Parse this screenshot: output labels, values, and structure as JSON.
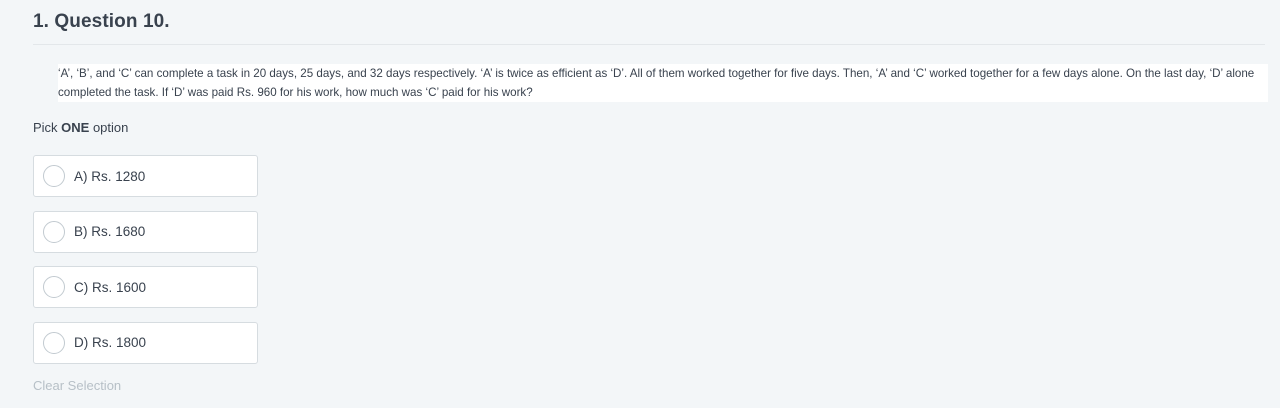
{
  "question_header": "1. Question 10.",
  "question_text": "‘A’, ‘B’, and ‘C’ can complete a task in 20 days, 25 days, and 32 days respectively. ‘A’ is twice as efficient as ‘D’. All of them worked together for five days. Then, ‘A’ and ‘C’ worked together for a few days alone. On the last day, ‘D’ alone completed the task. If ‘D’ was paid Rs. 960 for his work, how much was ‘C’ paid for his work?",
  "pick": {
    "prefix": "Pick ",
    "emphasis": "ONE",
    "suffix": " option"
  },
  "options": [
    {
      "label": "A) Rs. 1280",
      "selected": false
    },
    {
      "label": "B) Rs. 1680",
      "selected": false
    },
    {
      "label": "C) Rs. 1600",
      "selected": false
    },
    {
      "label": "D) Rs. 1800",
      "selected": false
    }
  ],
  "clear_selection": "Clear Selection"
}
